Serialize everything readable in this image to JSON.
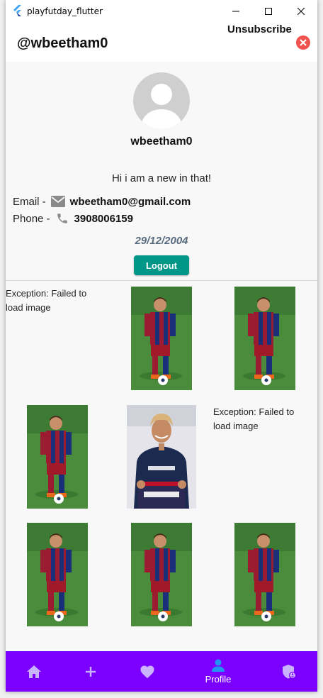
{
  "window": {
    "title": "playfutday_flutter"
  },
  "appbar": {
    "handle": "@wbeetham0",
    "unsubscribe_label": "Unsubscribe"
  },
  "profile": {
    "username": "wbeetham0",
    "bio": "Hi i am a new in that!",
    "email_label": "Email -",
    "email": "wbeetham0@gmail.com",
    "phone_label": "Phone -",
    "phone": "3908006159",
    "birthdate": "29/12/2004",
    "logout_label": "Logout"
  },
  "posts": {
    "error_text": "Exception: Failed to load image",
    "items": [
      "error",
      "messi",
      "messi",
      "messi",
      "neymar",
      "error",
      "messi",
      "messi",
      "messi"
    ]
  },
  "navbar": {
    "items": [
      {
        "icon": "home-icon"
      },
      {
        "icon": "add-icon"
      },
      {
        "icon": "heart-icon"
      },
      {
        "icon": "person-icon",
        "label": "Profile",
        "active": true
      },
      {
        "icon": "admin-shield-icon"
      }
    ]
  },
  "colors": {
    "accent": "#009688",
    "navbar": "#7c00ff",
    "unsubscribe": "#ef5350",
    "birthdate": "#586a7e"
  }
}
